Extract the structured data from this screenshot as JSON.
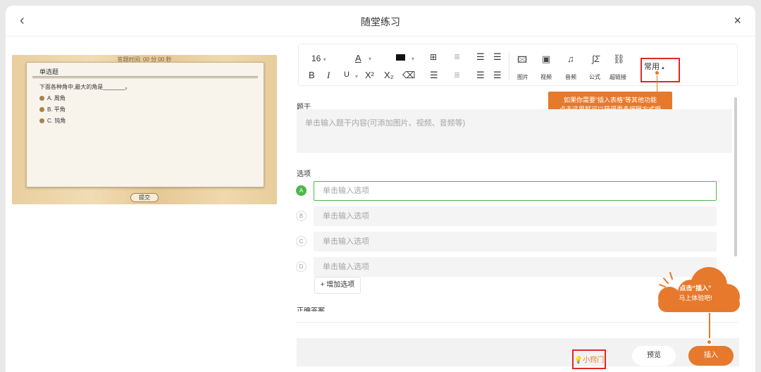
{
  "dialog": {
    "title": "随堂练习",
    "back_icon": "‹",
    "close_icon": "×"
  },
  "preview": {
    "timer": "答题时间:  00 分 00 秒",
    "question_type": "单选题",
    "question": "下面各种角中,最大的角是_______。",
    "options": [
      "A. 周角",
      "B. 平角",
      "C. 钝角"
    ],
    "submit_label": "提交"
  },
  "toolbar": {
    "font_size": "16",
    "dropdown_caret": "▾",
    "text_color_icon": "A",
    "bold": "B",
    "italic": "I",
    "underline": "U",
    "superscript": "X²",
    "subscript": "X₂",
    "media": {
      "image": "图片",
      "video": "视频",
      "audio": "音频",
      "formula": "公式",
      "link": "超链接"
    },
    "common_label": "常用",
    "common_caret": "▴"
  },
  "tooltip": {
    "line1": "如果你需要“插入表格”等其他功能",
    "line2": "点击这里就可以获得更多编辑方式哦"
  },
  "form": {
    "stem_label": "题干",
    "stem_placeholder": "单击输入题干内容(可添加图片、视频、音频等)",
    "options_label": "选项",
    "options": [
      {
        "letter": "A",
        "placeholder": "单击输入选项"
      },
      {
        "letter": "B",
        "placeholder": "单击输入选项"
      },
      {
        "letter": "C",
        "placeholder": "单击输入选项"
      },
      {
        "letter": "D",
        "placeholder": "单击输入选项"
      }
    ],
    "add_option_label": "+ 增加选项",
    "next_section_label": "正确答案"
  },
  "callout": {
    "line1": "点击“插入”",
    "line2": "马上体验吧!"
  },
  "footer": {
    "hint_icon": "lightbulb-icon",
    "hint_label": "小窍门",
    "preview_label": "预览",
    "insert_label": "插入"
  },
  "colors": {
    "accent": "#e6792c",
    "active_green": "#4cb749",
    "highlight_red": "#e02828"
  }
}
